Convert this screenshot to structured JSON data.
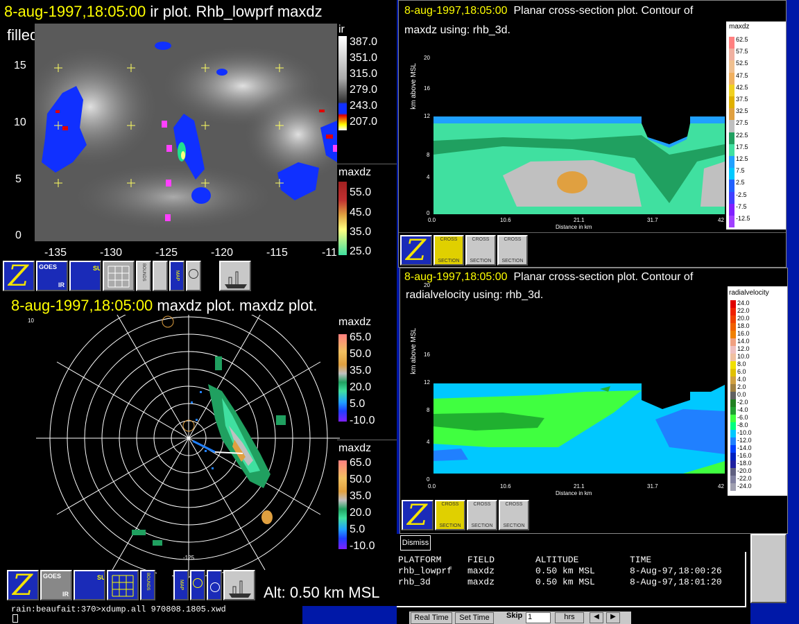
{
  "ir_window": {
    "title_time": "8-aug-1997,18:05:00",
    "title_rest": "ir plot.  Rhb_lowprf maxdz",
    "subtitle": "filled contour.",
    "y_ticks": [
      "15",
      "10",
      "5",
      "0"
    ],
    "x_ticks": [
      "-135",
      "-130",
      "-125",
      "-120",
      "-115",
      "-11"
    ],
    "legend_ir": {
      "title": "ir",
      "labels": [
        "387.0",
        "351.0",
        "315.0",
        "279.0",
        "243.0",
        "207.0"
      ]
    },
    "legend_maxdz": {
      "title": "maxdz",
      "labels": [
        "55.0",
        "45.0",
        "35.0",
        "25.0"
      ]
    },
    "toolbar": {
      "goes": "GOES",
      "ir": "IR",
      "sur": "SUR",
      "bounds": "BOUNDS",
      "map": "MAP"
    }
  },
  "radar_window": {
    "title_time": "8-aug-1997,18:05:00",
    "title_rest": "maxdz plot.  maxdz plot.",
    "legend1": {
      "title": "maxdz",
      "labels": [
        "65.0",
        "50.0",
        "35.0",
        "20.0",
        "5.0",
        "-10.0"
      ]
    },
    "legend2": {
      "title": "maxdz",
      "labels": [
        "65.0",
        "50.0",
        "35.0",
        "20.0",
        "5.0",
        "-10.0"
      ]
    },
    "altitude": "Alt: 0.50 km MSL",
    "corner_tl": "10",
    "bottom_tick": "-125",
    "toolbar": {
      "goes": "GOES",
      "ir": "IR",
      "sur": "SUR",
      "bounds": "BOUNDS",
      "map": "MAP"
    }
  },
  "cross1": {
    "title_time": "8-aug-1997,18:05:00",
    "title_rest": "Planar cross-section plot.  Contour of",
    "subtitle": "maxdz using: rhb_3d.",
    "ylabel": "km above MSL",
    "xlabel": "Distance in km",
    "y_ticks": [
      "20",
      "16",
      "12",
      "8",
      "4",
      "0"
    ],
    "x_ticks": [
      "0.0",
      "10.6",
      "21.1",
      "31.7",
      "42"
    ],
    "legend": {
      "title": "maxdz",
      "labels": [
        "62.5",
        "57.5",
        "52.5",
        "47.5",
        "42.5",
        "37.5",
        "32.5",
        "27.5",
        "22.5",
        "17.5",
        "12.5",
        "7.5",
        "2.5",
        "-2.5",
        "-7.5",
        "-12.5"
      ]
    },
    "buttons": {
      "cross": "CROSS",
      "section": "SECTION"
    }
  },
  "cross2": {
    "title_time": "8-aug-1997,18:05:00",
    "title_rest": "Planar cross-section plot.  Contour of",
    "subtitle": "radialvelocity using: rhb_3d.",
    "ylabel": "km above MSL",
    "xlabel": "Distance in km",
    "y_ticks": [
      "20",
      "16",
      "12",
      "8",
      "4",
      "0"
    ],
    "x_ticks": [
      "0.0",
      "10.6",
      "21.1",
      "31.7",
      "42"
    ],
    "legend": {
      "title": "radialvelocity",
      "labels": [
        "24.0",
        "22.0",
        "20.0",
        "18.0",
        "16.0",
        "14.0",
        "12.0",
        "10.0",
        "8.0",
        "6.0",
        "4.0",
        "2.0",
        "0.0",
        "-2.0",
        "-4.0",
        "-6.0",
        "-8.0",
        "-10.0",
        "-12.0",
        "-14.0",
        "-16.0",
        "-18.0",
        "-20.0",
        "-22.0",
        "-24.0"
      ]
    },
    "buttons": {
      "cross": "CROSS",
      "section": "SECTION"
    }
  },
  "dismiss": "Dismiss",
  "info_table": {
    "headers": [
      "PLATFORM",
      "FIELD",
      "ALTITUDE",
      "TIME"
    ],
    "rows": [
      [
        "rhb_lowprf",
        "maxdz",
        "0.50 km MSL",
        "8-Aug-97,18:00:26"
      ],
      [
        "rhb_3d",
        "maxdz",
        "0.50 km MSL",
        "8-Aug-97,18:01:20"
      ]
    ]
  },
  "terminal": {
    "line": "rain:beaufait:370>xdump.all 970808.1805.xwd"
  },
  "controls": {
    "real_time": "Real Time",
    "set_time": "Set Time",
    "skip": "Skip",
    "skip_value": "1",
    "hrs": "hrs"
  },
  "colors": {
    "title_yellow": "#ffff00",
    "desktop_blue": "#0018a8",
    "legend_bg": "#ffffff"
  }
}
